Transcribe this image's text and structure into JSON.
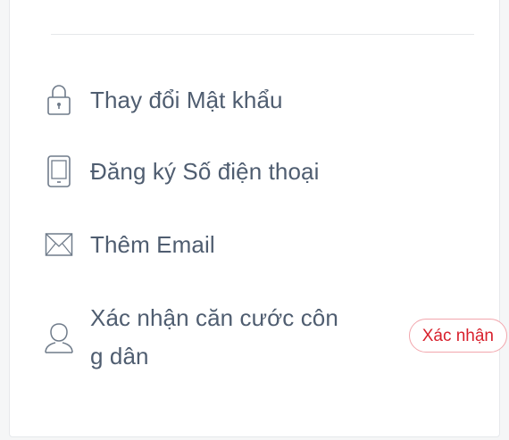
{
  "menu": {
    "items": [
      {
        "label": "Thay đổi Mật khẩu",
        "icon": "lock-icon"
      },
      {
        "label": "Đăng ký Số điện thoại",
        "icon": "phone-icon"
      },
      {
        "label": "Thêm Email",
        "icon": "envelope-icon"
      },
      {
        "label": "Xác nhận căn cước công dân",
        "icon": "user-icon"
      }
    ],
    "confirm_button": "Xác nhận"
  },
  "colors": {
    "text": "#4f5d70",
    "icon": "#6f7b8a",
    "accent": "#d8202c",
    "accent_border": "#f2a6ad"
  }
}
